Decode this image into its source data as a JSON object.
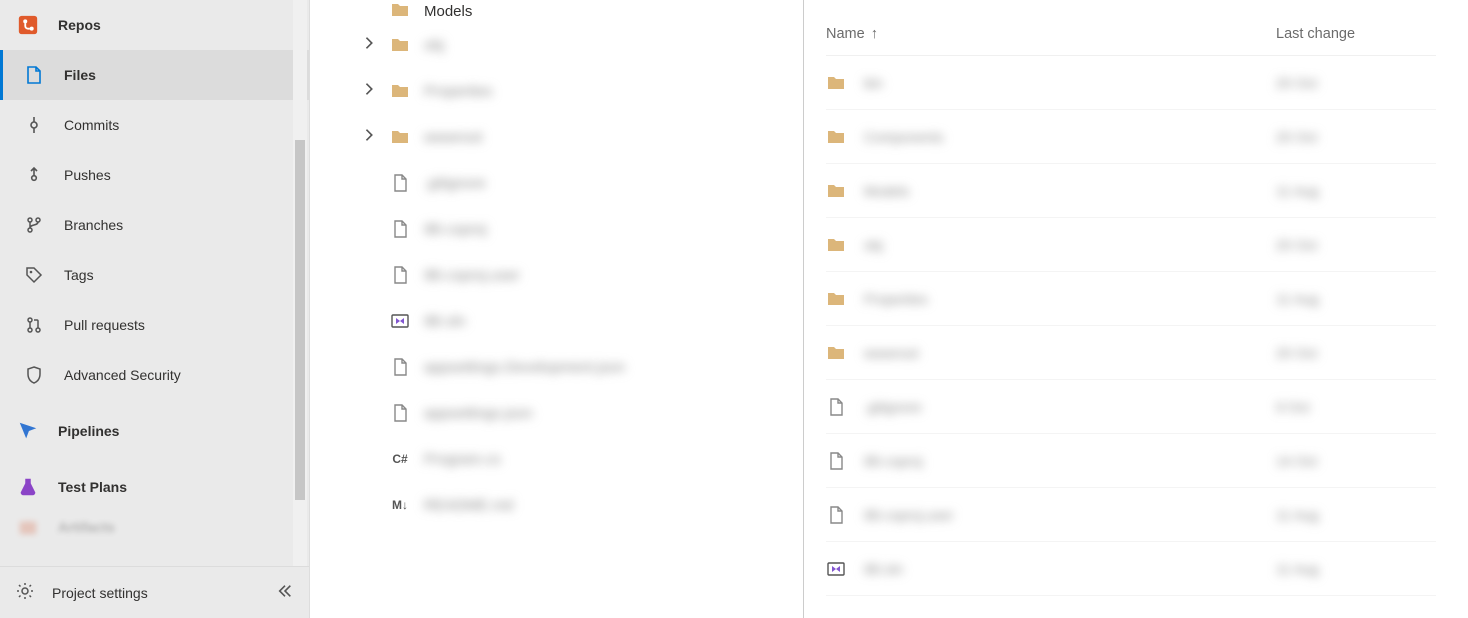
{
  "sidebar": {
    "repos": "Repos",
    "files": "Files",
    "commits": "Commits",
    "pushes": "Pushes",
    "branches": "Branches",
    "tags": "Tags",
    "pulls": "Pull requests",
    "advsec": "Advanced Security",
    "pipelines": "Pipelines",
    "testplans": "Test Plans",
    "artifacts": "Artifacts",
    "settings": "Project settings"
  },
  "tree": {
    "models": "Models",
    "obj": "obj",
    "properties": "Properties",
    "wwwroot": "wwwroot",
    "gitignore": ".gitignore",
    "csproj": "IBI.csproj",
    "csprojuser": "IBI.csproj.user",
    "sln": "IBI.sln",
    "appdev": "appsettings.Development.json",
    "appjson": "appsettings.json",
    "program": "Program.cs",
    "readme": "README.md"
  },
  "grid": {
    "header_name": "Name",
    "header_last": "Last change",
    "rows": [
      {
        "name": "bin",
        "last": "20 Oct",
        "type": "folder"
      },
      {
        "name": "Components",
        "last": "20 Oct",
        "type": "folder"
      },
      {
        "name": "Models",
        "last": "11 Aug",
        "type": "folder"
      },
      {
        "name": "obj",
        "last": "20 Oct",
        "type": "folder"
      },
      {
        "name": "Properties",
        "last": "11 Aug",
        "type": "folder"
      },
      {
        "name": "wwwroot",
        "last": "20 Oct",
        "type": "folder"
      },
      {
        "name": ".gitignore",
        "last": "9 Oct",
        "type": "file"
      },
      {
        "name": "IBI.csproj",
        "last": "14 Oct",
        "type": "file"
      },
      {
        "name": "IBI.csproj.user",
        "last": "11 Aug",
        "type": "file"
      },
      {
        "name": "IBI.sln",
        "last": "11 Aug",
        "type": "sln"
      }
    ]
  }
}
